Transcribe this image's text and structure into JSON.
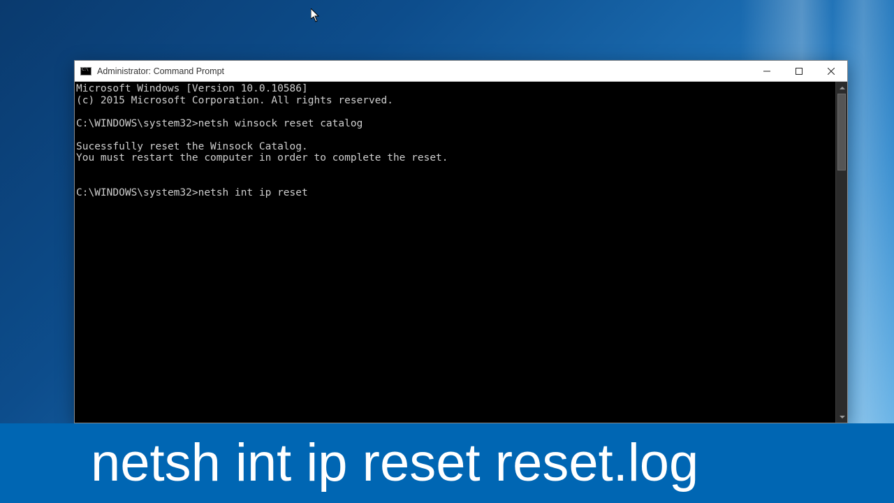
{
  "cursor": {
    "name": "arrow"
  },
  "window": {
    "title": "Administrator: Command Prompt",
    "buttons": {
      "min": "Minimize",
      "max": "Maximize",
      "close": "Close"
    },
    "console_lines": [
      "Microsoft Windows [Version 10.0.10586]",
      "(c) 2015 Microsoft Corporation. All rights reserved.",
      "",
      "C:\\WINDOWS\\system32>netsh winsock reset catalog",
      "",
      "Sucessfully reset the Winsock Catalog.",
      "You must restart the computer in order to complete the reset.",
      "",
      "",
      "C:\\WINDOWS\\system32>netsh int ip reset"
    ]
  },
  "caption": {
    "text": "netsh int ip reset reset.log"
  }
}
